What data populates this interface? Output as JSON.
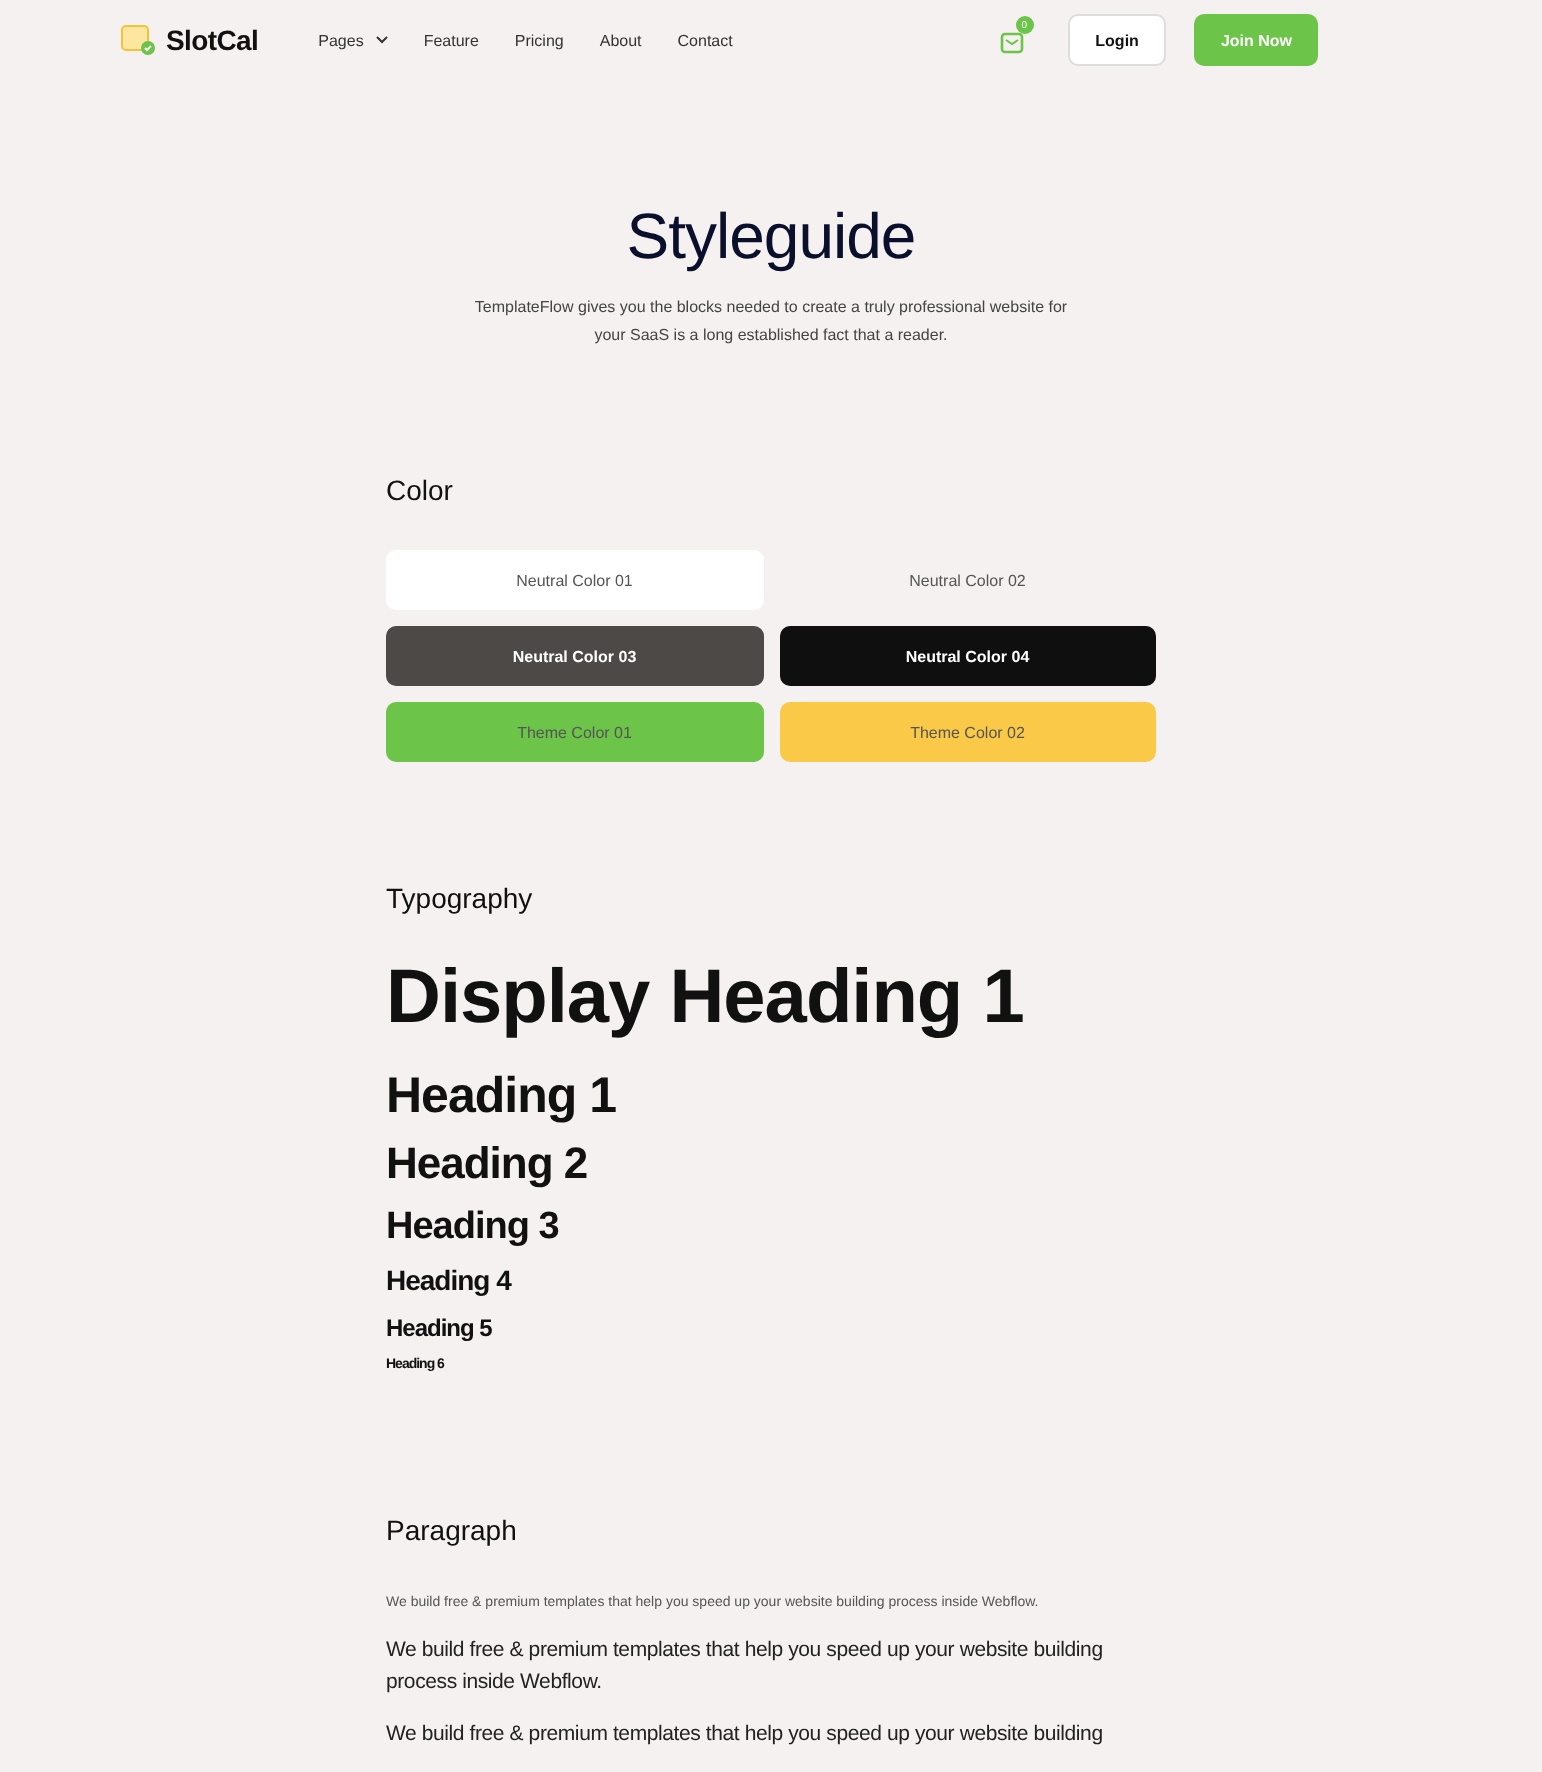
{
  "nav": {
    "brand": "SlotCal",
    "links": [
      {
        "label": "Pages",
        "dropdown": true
      },
      {
        "label": "Feature",
        "dropdown": false
      },
      {
        "label": "Pricing",
        "dropdown": false
      },
      {
        "label": "About",
        "dropdown": false
      },
      {
        "label": "Contact",
        "dropdown": false
      }
    ],
    "cart_count": "0",
    "login": "Login",
    "join": "Join Now"
  },
  "hero": {
    "title": "Styleguide",
    "subtitle": "TemplateFlow gives you the blocks needed to create a truly professional website for your SaaS is a long established fact that a reader."
  },
  "color": {
    "heading": "Color",
    "swatches": [
      {
        "label": "Neutral Color 01",
        "color": "#ffffff"
      },
      {
        "label": "Neutral Color 02",
        "color": "#f5f1f0"
      },
      {
        "label": "Neutral Color 03",
        "color": "#4d4946"
      },
      {
        "label": "Neutral Color 04",
        "color": "#0f0f0f"
      },
      {
        "label": "Theme Color 01",
        "color": "#6cc448"
      },
      {
        "label": "Theme Color 02",
        "color": "#fbc948"
      }
    ]
  },
  "typography": {
    "heading": "Typography",
    "samples": [
      {
        "kind": "display",
        "text": "Display Heading 1"
      },
      {
        "kind": "h1",
        "text": "Heading 1"
      },
      {
        "kind": "h2",
        "text": "Heading 2"
      },
      {
        "kind": "h3",
        "text": "Heading 3"
      },
      {
        "kind": "h4",
        "text": "Heading 4"
      },
      {
        "kind": "h5",
        "text": "Heading 5"
      },
      {
        "kind": "h6",
        "text": "Heading 6"
      }
    ]
  },
  "paragraph": {
    "heading": "Paragraph",
    "samples": [
      {
        "kind": "small",
        "text": "We build free & premium templates that help you speed up your website building process inside Webflow."
      },
      {
        "kind": "medium",
        "text": "We build free & premium templates that help you speed up your website building process inside Webflow."
      },
      {
        "kind": "large",
        "text": "We build free & premium templates that help you speed up your website building"
      }
    ]
  }
}
